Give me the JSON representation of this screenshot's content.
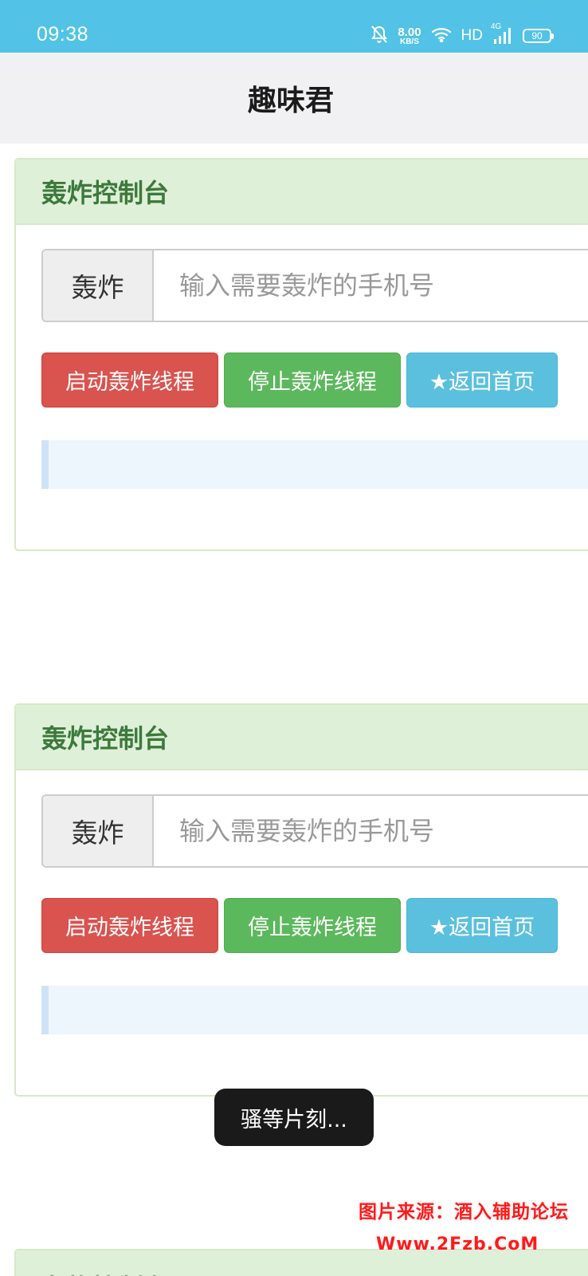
{
  "status_bar": {
    "time": "09:38",
    "speed_value": "8.00",
    "speed_unit": "KB/S",
    "hd": "HD",
    "network": "4G",
    "battery": "90",
    "icons": [
      "notification-muted-icon",
      "wifi-icon",
      "signal-icon",
      "battery-icon"
    ],
    "background": "#52c3e6"
  },
  "header": {
    "title": "趣味君"
  },
  "panels": [
    {
      "title": "轰炸控制台",
      "addon_label": "轰炸",
      "input_placeholder": "输入需要轰炸的手机号",
      "input_value": "",
      "buttons": {
        "start": "启动轰炸线程",
        "stop": "停止轰炸线程",
        "home": "★返回首页"
      }
    },
    {
      "title": "轰炸控制台",
      "addon_label": "轰炸",
      "input_placeholder": "输入需要轰炸的手机号",
      "input_value": "",
      "buttons": {
        "start": "启动轰炸线程",
        "stop": "停止轰炸线程",
        "home": "★返回首页"
      }
    },
    {
      "title": "轰炸控制台"
    }
  ],
  "toast": {
    "text": "骚等片刻..."
  },
  "watermark": {
    "line1": "图片来源：酒入辅助论坛",
    "line2": "Www.2Fzb.CoM"
  },
  "colors": {
    "panel_header_bg": "#dff0d8",
    "panel_title": "#3c7a3b",
    "btn_start": "#d9534f",
    "btn_stop": "#5cb85c",
    "btn_home": "#5bc0de",
    "info_box": "#edf5fd"
  }
}
